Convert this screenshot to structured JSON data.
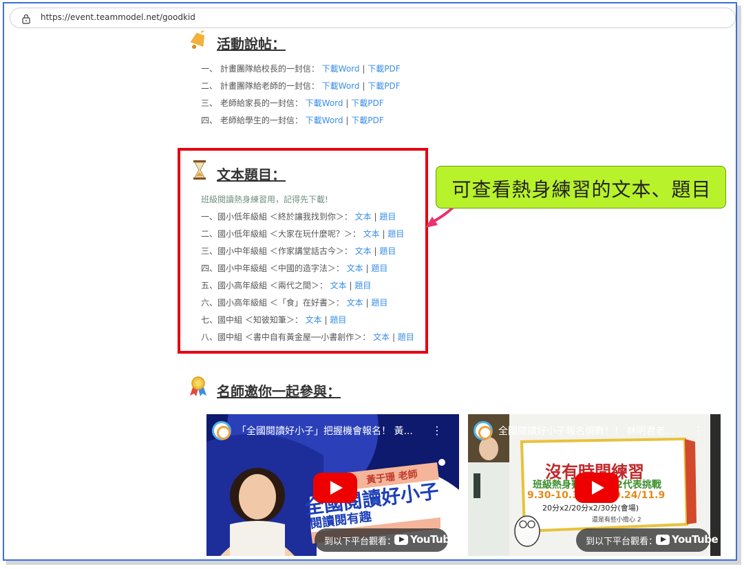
{
  "browser": {
    "url": "https://event.teammodel.net/goodkid"
  },
  "section1": {
    "title": "活動說帖：",
    "items": [
      {
        "label": "一、 計畫團隊給校長的一封信：",
        "word": "下載Word",
        "pdf": "下載PDF"
      },
      {
        "label": "二、 計畫團隊給老師的一封信：",
        "word": "下載Word",
        "pdf": "下載PDF"
      },
      {
        "label": "三、 老師給家長的一封信：",
        "word": "下載Word",
        "pdf": "下載PDF"
      },
      {
        "label": "四、 老師給學生的一封信：",
        "word": "下載Word",
        "pdf": "下載PDF"
      }
    ]
  },
  "section2": {
    "title": "文本題目：",
    "note": "班級閱讀熱身練習用，記得先下載!",
    "items": [
      {
        "label": "一、國小低年級組 ＜終於讓我找到你＞：",
        "text": "文本",
        "questions": "題目"
      },
      {
        "label": "二、國小低年級組 ＜大家在玩什麼呢？＞：",
        "text": "文本",
        "questions": "題目"
      },
      {
        "label": "三、國小中年級組 ＜作家講堂話古今＞：",
        "text": "文本",
        "questions": "題目"
      },
      {
        "label": "四、國小中年級組 ＜中國的造字法＞：",
        "text": "文本",
        "questions": "題目"
      },
      {
        "label": "五、國小高年級組 ＜兩代之間＞：",
        "text": "文本",
        "questions": "題目"
      },
      {
        "label": "六、國小高年級組 ＜「食」在好書＞：",
        "text": "文本",
        "questions": "題目"
      },
      {
        "label": "七、國中組 ＜知彼知筆＞：",
        "text": "文本",
        "questions": "題目"
      },
      {
        "label": "八、國中組 ＜書中自有黃金屋──小書創作＞：",
        "text": "文本",
        "questions": "題目"
      }
    ]
  },
  "callout": {
    "text": "可查看熱身練習的文本、題目"
  },
  "section3": {
    "title": "名師邀你一起參與："
  },
  "videos": [
    {
      "title": "「全國閱讀好小子」把握機會報名！ 黃...",
      "watch_on": "到以下平台觀看：",
      "platform": "YouTube",
      "thumb_texts": [
        "黃于珊 老師",
        "全國閱讀好小子",
        "閱讀閱有趣"
      ]
    },
    {
      "title": "全國閱讀好小子報名倒數！！ 林明君老...",
      "watch_on": "到以下平台觀看：",
      "platform": "YouTube",
      "thumb_texts": [
        "沒有時間練習",
        "班級熱身賽",
        "/2代表挑戰",
        "9.30-10.18",
        "0.24/11.9",
        "20分x2/20分x2/30分(會場)",
        "還是有些小擔心 2"
      ]
    }
  ],
  "colors": {
    "link": "#3a8ee6",
    "highlight_box": "#e60012",
    "callout_bg": "#b8f22a",
    "arrow": "#e8336d",
    "frame": "#3a6fd8"
  }
}
